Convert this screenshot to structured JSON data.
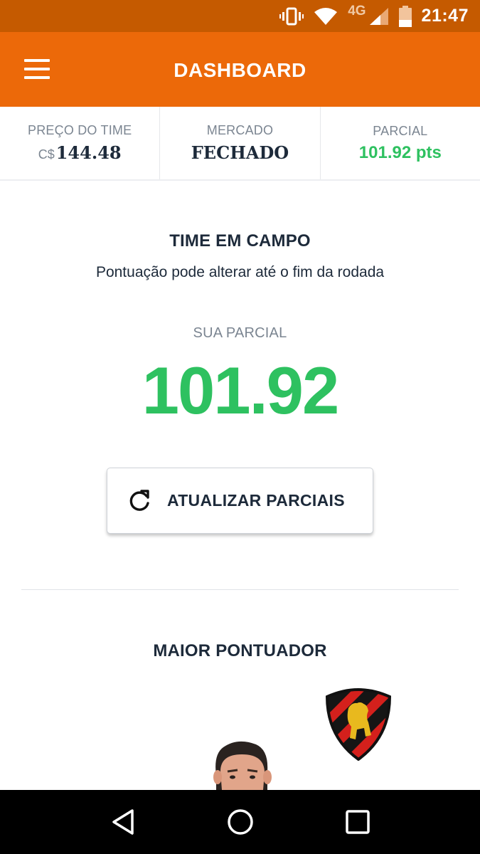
{
  "status_bar": {
    "network": "4G",
    "time": "21:47",
    "icons": [
      "vibrate-icon",
      "wifi-icon",
      "signal-icon",
      "battery-icon"
    ]
  },
  "app_bar": {
    "title": "DASHBOARD",
    "menu_icon": "hamburger-menu-icon"
  },
  "stats": {
    "team_price": {
      "label": "PREÇO DO TIME",
      "currency": "C$",
      "value": "144.48"
    },
    "market": {
      "label": "MERCADO",
      "value": "FECHADO"
    },
    "partial": {
      "label": "PARCIAL",
      "value": "101.92 pts"
    }
  },
  "main": {
    "section_title": "TIME EM CAMPO",
    "subtitle": "Pontuação pode alterar até o fim da rodada",
    "score_label": "SUA PARCIAL",
    "score_value": "101.92",
    "refresh_button": {
      "label": "ATUALIZAR PARCIAIS",
      "icon": "refresh-icon"
    }
  },
  "top_scorer": {
    "title": "MAIOR PONTUADOR",
    "club_crest": "club-crest",
    "player_photo": "player-photo"
  },
  "nav_bar": {
    "buttons": [
      "back-icon",
      "home-icon",
      "recents-icon"
    ]
  },
  "colors": {
    "status_bar": "#c55a00",
    "app_bar": "#ec6909",
    "green": "#2ec160",
    "dark_text": "#1d2a3a",
    "muted_text": "#7b8591"
  }
}
